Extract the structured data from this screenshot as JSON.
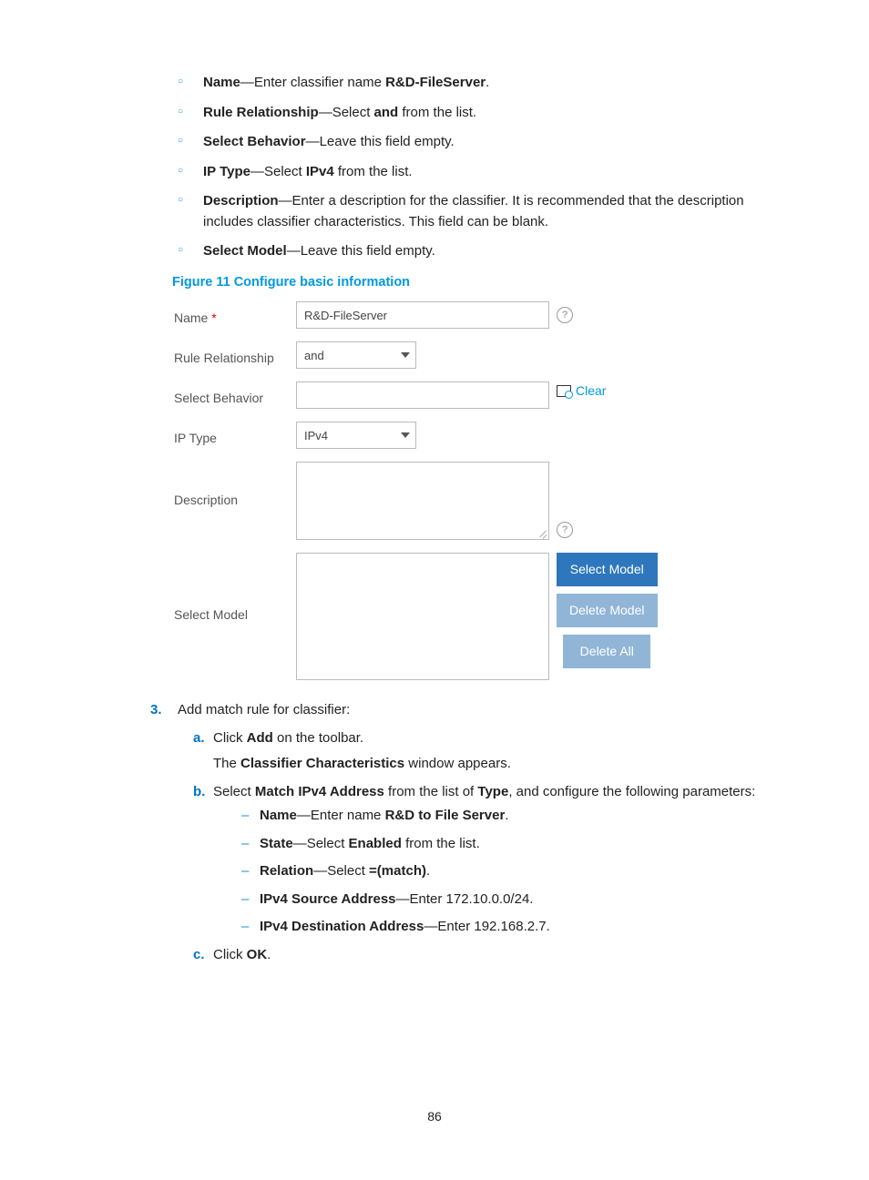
{
  "bullets": {
    "name_field": "Name",
    "name_text1": "—Enter classifier name ",
    "name_val": "R&D-FileServer",
    "name_text2": ".",
    "rule_field": "Rule Relationship",
    "rule_text1": "—Select ",
    "rule_val": "and",
    "rule_text2": " from the list.",
    "behavior_field": "Select Behavior",
    "behavior_text": "—Leave this field empty.",
    "iptype_field": "IP Type",
    "iptype_text1": "—Select ",
    "iptype_val": "IPv4",
    "iptype_text2": " from the list.",
    "desc_field": "Description",
    "desc_text": "—Enter a description for the classifier. It is recommended that the description includes classifier characteristics. This field can be blank.",
    "model_field": "Select Model",
    "model_text": "—Leave this field empty."
  },
  "figure_caption": "Figure 11 Configure basic information",
  "form": {
    "name_label": "Name",
    "name_req": " *",
    "name_value": "R&D-FileServer",
    "rule_label": "Rule Relationship",
    "rule_value": "and",
    "behavior_label": "Select Behavior",
    "clear_label": "Clear",
    "iptype_label": "IP Type",
    "iptype_value": "IPv4",
    "desc_label": "Description",
    "model_label": "Select Model",
    "btn_select_model": "Select Model",
    "btn_delete_model": "Delete Model",
    "btn_delete_all": "Delete All"
  },
  "step3": {
    "num": "3.",
    "intro": "Add match rule for classifier:",
    "a_num": "a.",
    "a_text1": "Click ",
    "a_bold": "Add",
    "a_text2": " on the toolbar.",
    "a_line2_pre": "The ",
    "a_line2_bold": "Classifier Characteristics",
    "a_line2_post": " window appears.",
    "b_num": "b.",
    "b_text1": "Select ",
    "b_bold1": "Match IPv4 Address",
    "b_text2": " from the list of ",
    "b_bold2": "Type",
    "b_text3": ", and configure the following parameters:",
    "d1_field": "Name",
    "d1_text1": "—Enter name ",
    "d1_val": "R&D to File Server",
    "d1_text2": ".",
    "d2_field": "State",
    "d2_text1": "—Select ",
    "d2_val": "Enabled",
    "d2_text2": " from the list.",
    "d3_field": "Relation",
    "d3_text1": "—Select ",
    "d3_val": "=(match)",
    "d3_text2": ".",
    "d4_field": "IPv4 Source Address",
    "d4_text": "—Enter 172.10.0.0/24.",
    "d5_field": "IPv4 Destination Address",
    "d5_text": "—Enter 192.168.2.7.",
    "c_num": "c.",
    "c_text1": "Click ",
    "c_bold": "OK",
    "c_text2": "."
  },
  "page_number": "86"
}
